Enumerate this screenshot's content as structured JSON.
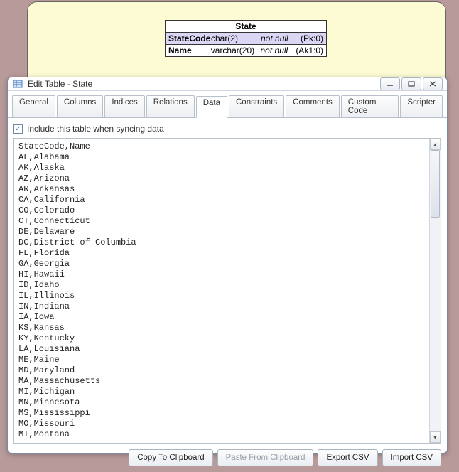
{
  "entity": {
    "title": "State",
    "rows": [
      {
        "name": "StateCode",
        "type": "char(2)",
        "nullable": "not null",
        "key": "(Pk:0)",
        "pk": true
      },
      {
        "name": "Name",
        "type": "varchar(20)",
        "nullable": "not null",
        "key": "(Ak1:0)",
        "pk": false
      }
    ]
  },
  "window": {
    "title": "Edit Table - State",
    "tabs": [
      "General",
      "Columns",
      "Indices",
      "Relations",
      "Data",
      "Constraints",
      "Comments",
      "Custom Code",
      "Scripter"
    ],
    "activeTab": "Data",
    "checkboxLabel": "Include this table when syncing data",
    "checkboxChecked": true,
    "buttons": {
      "copy": "Copy To Clipboard",
      "paste": "Paste From Clipboard",
      "export": "Export CSV",
      "import": "Import CSV"
    },
    "data": "StateCode,Name\nAL,Alabama\nAK,Alaska\nAZ,Arizona\nAR,Arkansas\nCA,California\nCO,Colorado\nCT,Connecticut\nDE,Delaware\nDC,District of Columbia\nFL,Florida\nGA,Georgia\nHI,Hawaii\nID,Idaho\nIL,Illinois\nIN,Indiana\nIA,Iowa\nKS,Kansas\nKY,Kentucky\nLA,Louisiana\nME,Maine\nMD,Maryland\nMA,Massachusetts\nMI,Michigan\nMN,Minnesota\nMS,Mississippi\nMO,Missouri\nMT,Montana"
  }
}
